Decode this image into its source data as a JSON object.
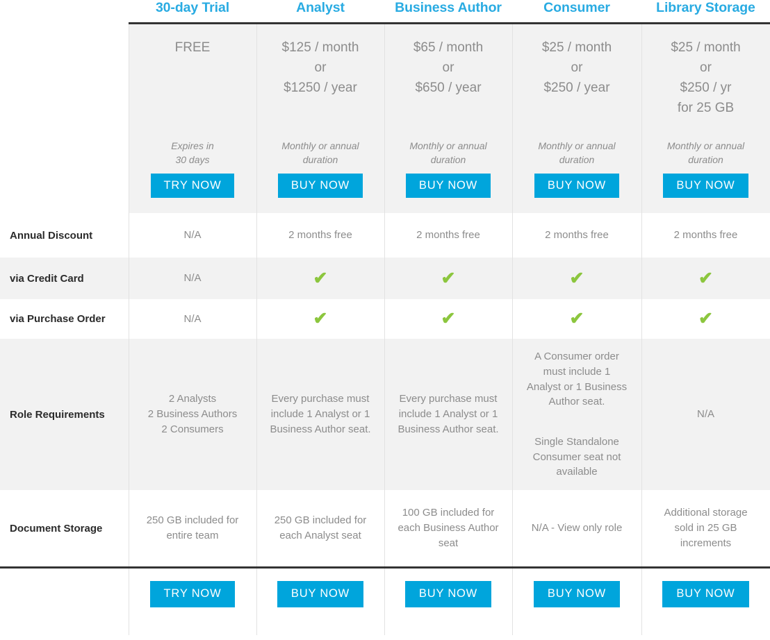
{
  "columns": [
    {
      "key": "label",
      "header": ""
    },
    {
      "key": "trial",
      "header": "30-day Trial"
    },
    {
      "key": "analyst",
      "header": "Analyst"
    },
    {
      "key": "bizauth",
      "header": "Business Author"
    },
    {
      "key": "consumer",
      "header": "Consumer"
    },
    {
      "key": "library",
      "header": "Library Storage"
    }
  ],
  "colors": {
    "header_blue": "#29ABE2",
    "button_blue": "#00A5DC",
    "check_green": "#8CC63E",
    "shade_gray": "#F2F2F2",
    "rule_dark": "#333333",
    "body_text": "#8C8C8C",
    "label_text": "#2B2B2B"
  },
  "price_row": {
    "trial": {
      "price_lines": [
        "FREE"
      ],
      "note_lines": [
        "Expires in",
        "30 days"
      ],
      "cta_label": "TRY NOW"
    },
    "analyst": {
      "price_lines": [
        "$125 / month",
        "or",
        "$1250 / year"
      ],
      "note_lines": [
        "Monthly or annual",
        "duration"
      ],
      "cta_label": "BUY NOW"
    },
    "bizauth": {
      "price_lines": [
        "$65 / month",
        "or",
        "$650 / year"
      ],
      "note_lines": [
        "Monthly or annual",
        "duration"
      ],
      "cta_label": "BUY NOW"
    },
    "consumer": {
      "price_lines": [
        "$25 / month",
        "or",
        "$250 / year"
      ],
      "note_lines": [
        "Monthly or annual",
        "duration"
      ],
      "cta_label": "BUY NOW"
    },
    "library": {
      "price_lines": [
        "$25 / month",
        "or",
        "$250 / yr",
        "for 25 GB"
      ],
      "note_lines": [
        "Monthly or annual",
        "duration"
      ],
      "cta_label": "BUY NOW"
    }
  },
  "rows": [
    {
      "label": "Annual Discount",
      "cells": [
        {
          "type": "text",
          "lines": [
            "N/A"
          ]
        },
        {
          "type": "text",
          "lines": [
            "2 months free"
          ]
        },
        {
          "type": "text",
          "lines": [
            "2 months free"
          ]
        },
        {
          "type": "text",
          "lines": [
            "2 months free"
          ]
        },
        {
          "type": "text",
          "lines": [
            "2 months free"
          ]
        }
      ]
    },
    {
      "label": "via Credit Card",
      "cells": [
        {
          "type": "text",
          "lines": [
            "N/A"
          ]
        },
        {
          "type": "check",
          "glyph": "✔"
        },
        {
          "type": "check",
          "glyph": "✔"
        },
        {
          "type": "check",
          "glyph": "✔"
        },
        {
          "type": "check",
          "glyph": "✔"
        }
      ]
    },
    {
      "label": "via Purchase Order",
      "cells": [
        {
          "type": "text",
          "lines": [
            "N/A"
          ]
        },
        {
          "type": "check",
          "glyph": "✔"
        },
        {
          "type": "check",
          "glyph": "✔"
        },
        {
          "type": "check",
          "glyph": "✔"
        },
        {
          "type": "check",
          "glyph": "✔"
        }
      ]
    },
    {
      "label": "Role Requirements",
      "cells": [
        {
          "type": "text",
          "lines": [
            "2 Analysts",
            "2 Business Authors",
            "2 Consumers"
          ]
        },
        {
          "type": "text",
          "lines": [
            "Every purchase must",
            "include 1 Analyst or 1",
            "Business Author seat."
          ]
        },
        {
          "type": "text",
          "lines": [
            "Every purchase must",
            "include 1 Analyst or 1",
            "Business Author seat."
          ]
        },
        {
          "type": "text",
          "lines": [
            "A Consumer order",
            "must include 1",
            "Analyst or 1 Business",
            "Author seat.",
            "",
            "Single Standalone",
            "Consumer seat not",
            "available"
          ]
        },
        {
          "type": "text",
          "lines": [
            "N/A"
          ]
        }
      ]
    },
    {
      "label": "Document Storage",
      "cells": [
        {
          "type": "text",
          "lines": [
            "250 GB included for",
            "entire team"
          ]
        },
        {
          "type": "text",
          "lines": [
            "250 GB included for",
            "each Analyst seat"
          ]
        },
        {
          "type": "text",
          "lines": [
            "100 GB included for",
            "each Business Author",
            "seat"
          ]
        },
        {
          "type": "text",
          "lines": [
            "N/A - View only role"
          ]
        },
        {
          "type": "text",
          "lines": [
            "Additional storage",
            "sold in 25 GB",
            "increments"
          ]
        }
      ]
    }
  ],
  "footer_row": {
    "label": "",
    "ctas": [
      "TRY NOW",
      "BUY NOW",
      "BUY NOW",
      "BUY NOW",
      "BUY NOW"
    ]
  }
}
